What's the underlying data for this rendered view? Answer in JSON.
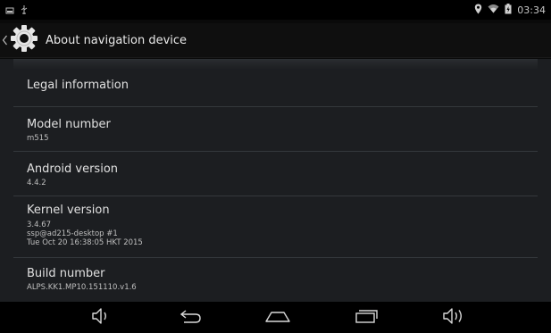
{
  "status_bar": {
    "time": "03:34",
    "left_icons": [
      "screenshot-notification-icon",
      "usb-icon"
    ],
    "right_icons": [
      "location-icon",
      "wifi-icon",
      "battery-icon"
    ]
  },
  "action_bar": {
    "title": "About navigation device",
    "icon": "settings-gear-icon"
  },
  "items": [
    {
      "title": "Legal information"
    },
    {
      "title": "Model number",
      "subtitle": "m515"
    },
    {
      "title": "Android version",
      "subtitle": "4.4.2"
    },
    {
      "title": "Kernel version",
      "subtitle_lines": [
        "3.4.67",
        "ssp@ad215-desktop #1",
        "Tue Oct 20 16:38:05 HKT 2015"
      ]
    },
    {
      "title": "Build number",
      "subtitle": "ALPS.KK1.MP10.151110.v1.6"
    }
  ],
  "nav_bar": [
    "volume-down-icon",
    "back-icon",
    "home-icon",
    "recent-apps-icon",
    "volume-up-icon"
  ],
  "colors": {
    "background": "#1c1e21",
    "divider": "#34383c",
    "text_primary": "#e0e0e0",
    "text_secondary": "#bfbfbf"
  }
}
